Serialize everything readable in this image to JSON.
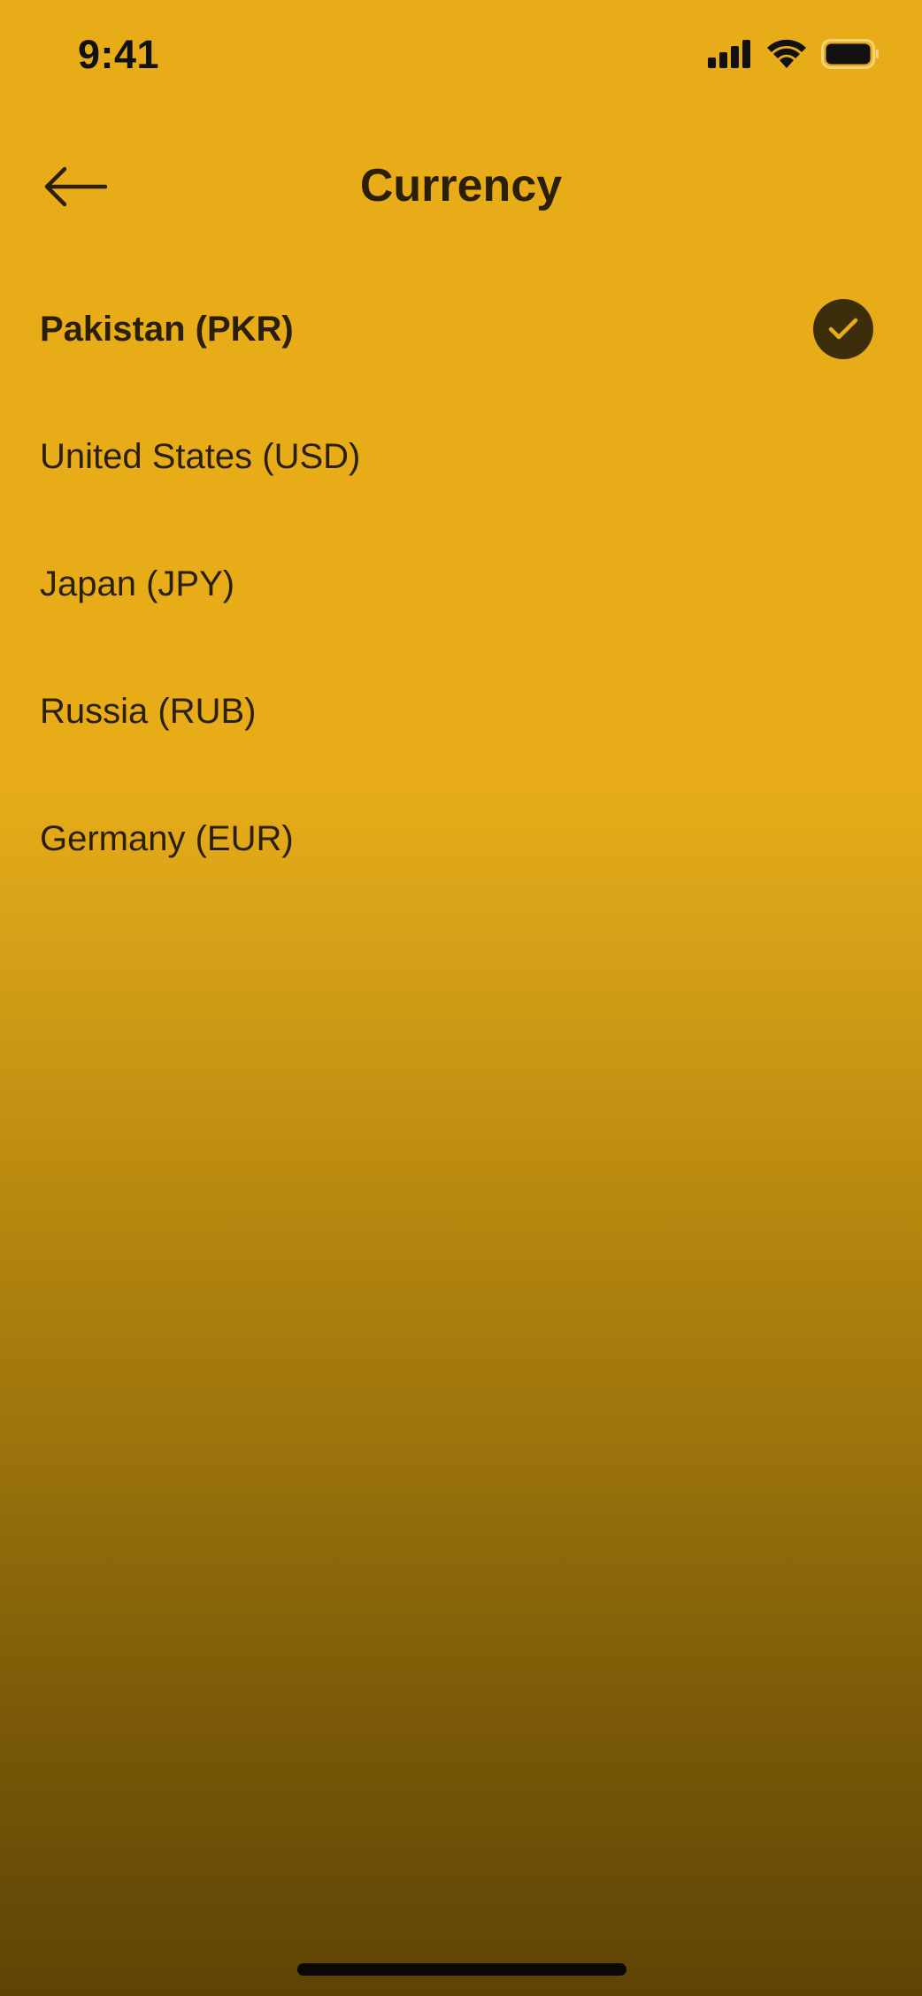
{
  "status_bar": {
    "time": "9:41",
    "icons": [
      "cellular-signal-icon",
      "wifi-icon",
      "battery-icon"
    ]
  },
  "header": {
    "title": "Currency",
    "back_icon": "arrow-left-icon"
  },
  "currencies": [
    {
      "label": "Pakistan (PKR)",
      "selected": true
    },
    {
      "label": "United States (USD)",
      "selected": false
    },
    {
      "label": "Japan (JPY)",
      "selected": false
    },
    {
      "label": "Russia (RUB)",
      "selected": false
    },
    {
      "label": "Germany (EUR)",
      "selected": false
    }
  ],
  "selected_icon": "checkmark-icon",
  "colors": {
    "background_top": "#E8AC18",
    "background_bottom": "#5E4306",
    "text": "#2A200A",
    "check_badge": "#3D2E0B",
    "check_mark": "#E8AC18"
  }
}
